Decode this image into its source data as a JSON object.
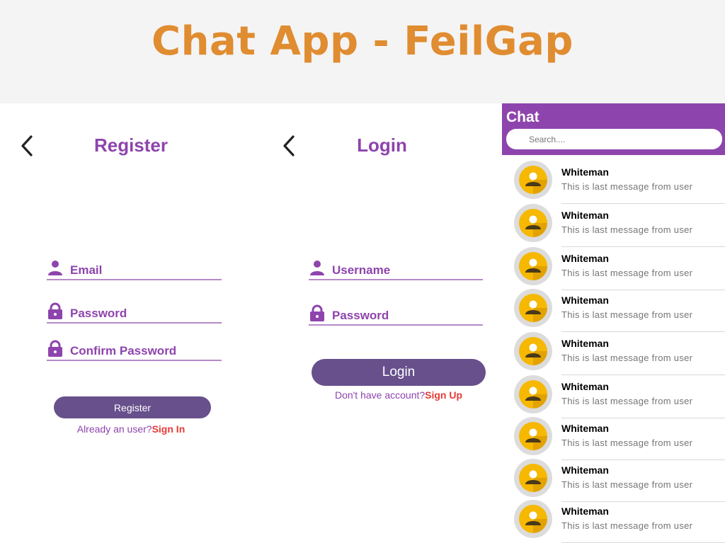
{
  "banner": {
    "title": "Chat App - FeilGap"
  },
  "register": {
    "title": "Register",
    "fields": [
      {
        "icon": "person-icon",
        "label": "Email"
      },
      {
        "icon": "lock-icon",
        "label": "Password"
      },
      {
        "icon": "lock-icon",
        "label": "Confirm Password"
      }
    ],
    "button_label": "Register",
    "switch_prompt": "Already an user?",
    "switch_link": "Sign In"
  },
  "login": {
    "title": "Login",
    "fields": [
      {
        "icon": "person-icon",
        "label": "Username"
      },
      {
        "icon": "lock-icon",
        "label": "Password"
      }
    ],
    "button_label": "Login",
    "switch_prompt": "Don't have account?",
    "switch_link": "Sign Up"
  },
  "chat": {
    "title": "Chat",
    "search_placeholder": "Search....",
    "items": [
      {
        "name": "Whiteman",
        "message": "This is last message from user"
      },
      {
        "name": "Whiteman",
        "message": "This is last message from user"
      },
      {
        "name": "Whiteman",
        "message": "This is last message from user"
      },
      {
        "name": "Whiteman",
        "message": "This is last message from user"
      },
      {
        "name": "Whiteman",
        "message": "This is last message from user"
      },
      {
        "name": "Whiteman",
        "message": "This is last message from user"
      },
      {
        "name": "Whiteman",
        "message": "This is last message from user"
      },
      {
        "name": "Whiteman",
        "message": "This is last message from user"
      },
      {
        "name": "Whiteman",
        "message": "This is last message from user"
      }
    ]
  },
  "colors": {
    "banner_title": "#e08c30",
    "accent_purple": "#8e44ad",
    "button_purple": "#67508c",
    "link_red": "#e53935",
    "avatar_yellow": "#f6b800"
  }
}
